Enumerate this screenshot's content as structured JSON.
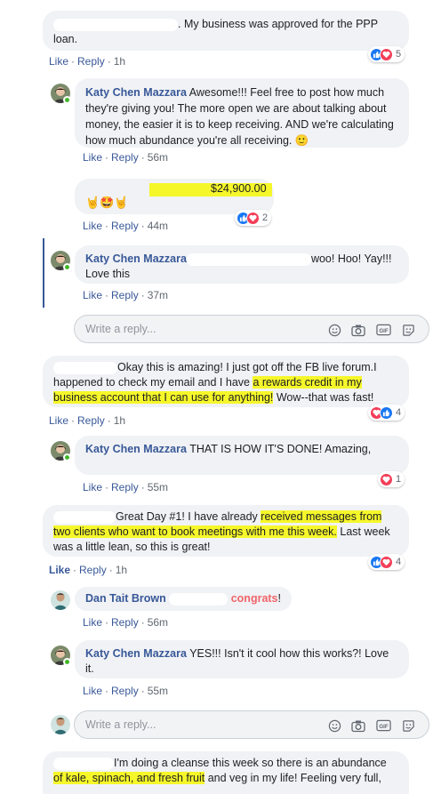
{
  "like_label": "Like",
  "reply_label": "Reply",
  "dot": "·",
  "reply_placeholder": "Write a reply...",
  "comments": [
    {
      "text": ". My business was approved for the PPP loan.",
      "time": "1h",
      "reactions": "5"
    },
    {
      "author": "Katy Chen Mazzara",
      "text": "Awesome!!! Feel free to post how much they're giving you! The more open we are about talking about money, the easier it is to keep receiving. AND we're calculating how much abundance you're all receiving. 🙂",
      "time": "56m"
    },
    {
      "emojis": "🤘🤩🤘",
      "amount": "$24,900.00",
      "time": "44m",
      "reactions": "2"
    },
    {
      "author": "Katy Chen Mazzara",
      "text_after": "woo! Hoo! Yay!!! Love this",
      "time": "37m"
    },
    {
      "text_a": "Okay this is amazing! I just got off the FB live forum.I happened to check my email and I have ",
      "highlight": "a rewards credit in my business account that I can use for anything!",
      "text_b": " Wow--that was fast!",
      "time": "1h",
      "reactions": "4"
    },
    {
      "author": "Katy Chen Mazzara",
      "text": "THAT IS HOW IT'S DONE! Amazing,",
      "time": "55m",
      "reactions": "1"
    },
    {
      "text_a": "Great Day #1! I have already ",
      "highlight_a": "received messages from",
      "highlight_b": "two clients who want to book meetings with me this week.",
      "text_b": " Last week was a little lean, so this is great!",
      "time": "1h",
      "reactions": "4"
    },
    {
      "author": "Dan Tait Brown",
      "congrats": "congrats",
      "bang": "!",
      "time": "56m"
    },
    {
      "author": "Katy Chen Mazzara",
      "text": "YES!!! Isn't it cool how this works?! Love it.",
      "time": "55m"
    },
    {
      "text_a": "I'm doing a cleanse this week so there is an abundance",
      "highlight": "of kale, spinach, and fresh fruit",
      "text_b": " and veg in my life! Feeling very full,"
    }
  ],
  "colors": {
    "link": "#385898",
    "highlight": "#f6f72a",
    "bubble": "#f0f2f5",
    "like": "#1877f2",
    "love": "#f33e58",
    "online": "#42b72a"
  }
}
